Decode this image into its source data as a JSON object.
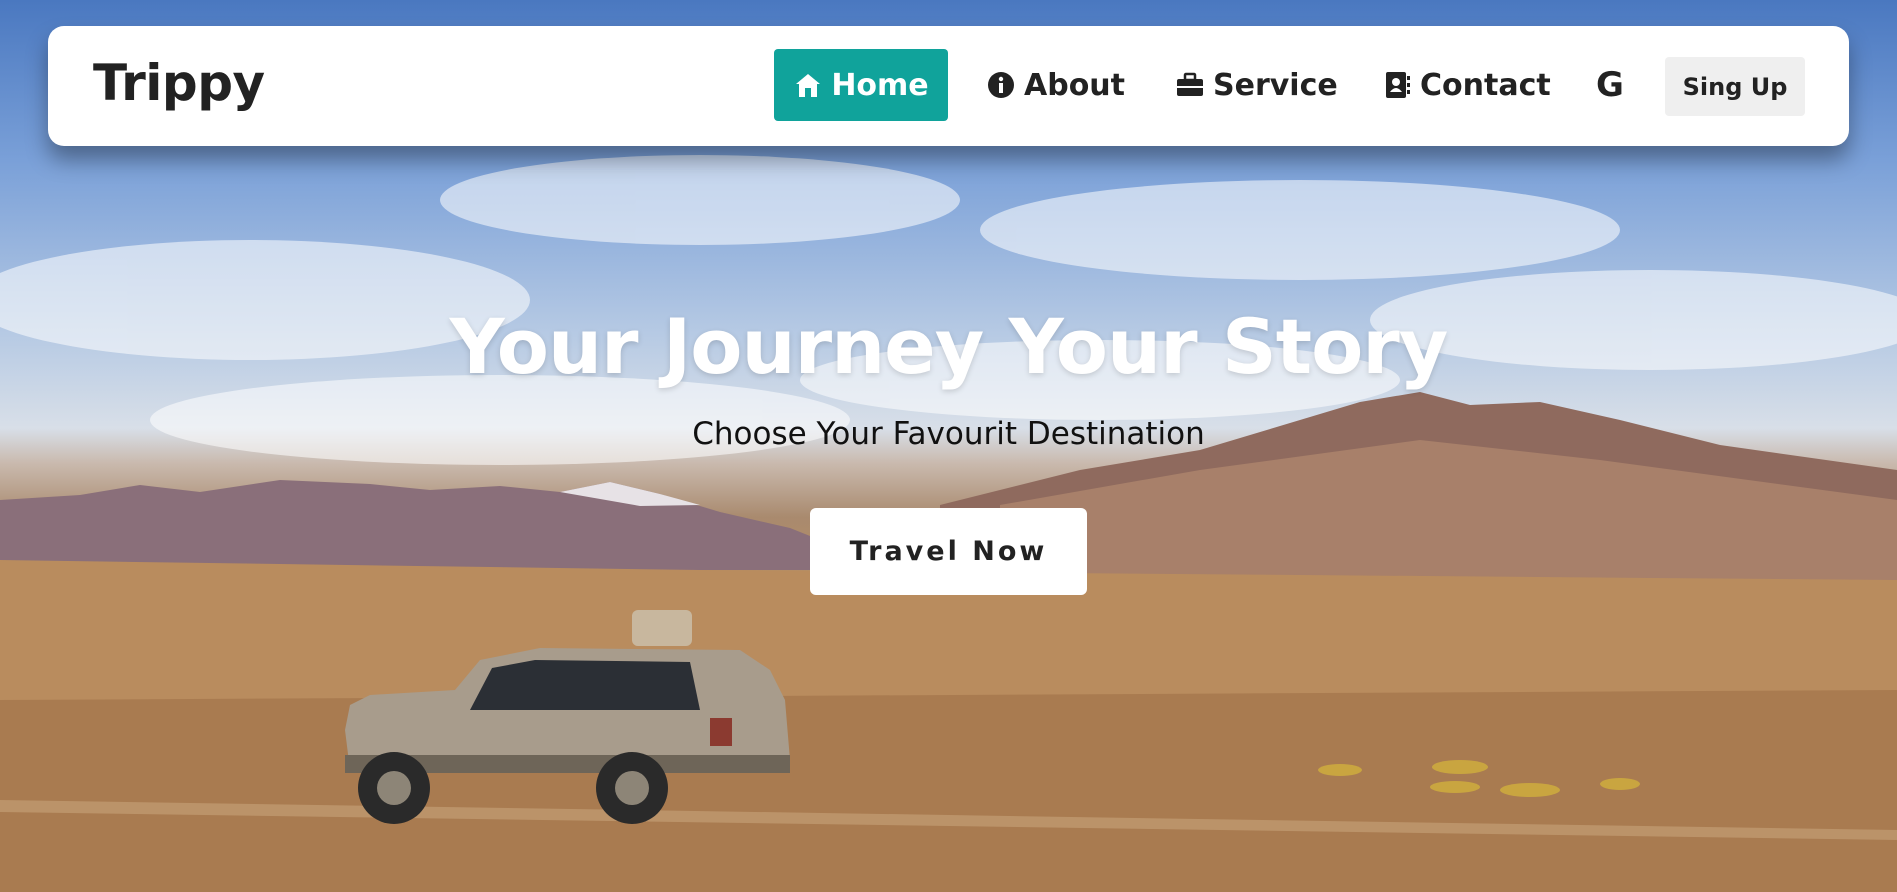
{
  "brand": "Trippy",
  "nav": {
    "home": "Home",
    "about": "About",
    "service": "Service",
    "contact": "Contact",
    "google": "G",
    "signup": "Sing Up"
  },
  "hero": {
    "title": "Your Journey Your Story",
    "subtitle": "Choose Your Favourit Destination",
    "cta": "Travel Now"
  },
  "colors": {
    "accent": "#10a39b",
    "navbar_bg": "#ffffff",
    "signup_bg": "#efefef"
  },
  "icons": {
    "home": "house-icon",
    "about": "info-circle-icon",
    "service": "briefcase-icon",
    "contact": "address-book-icon",
    "google": "google-icon"
  }
}
